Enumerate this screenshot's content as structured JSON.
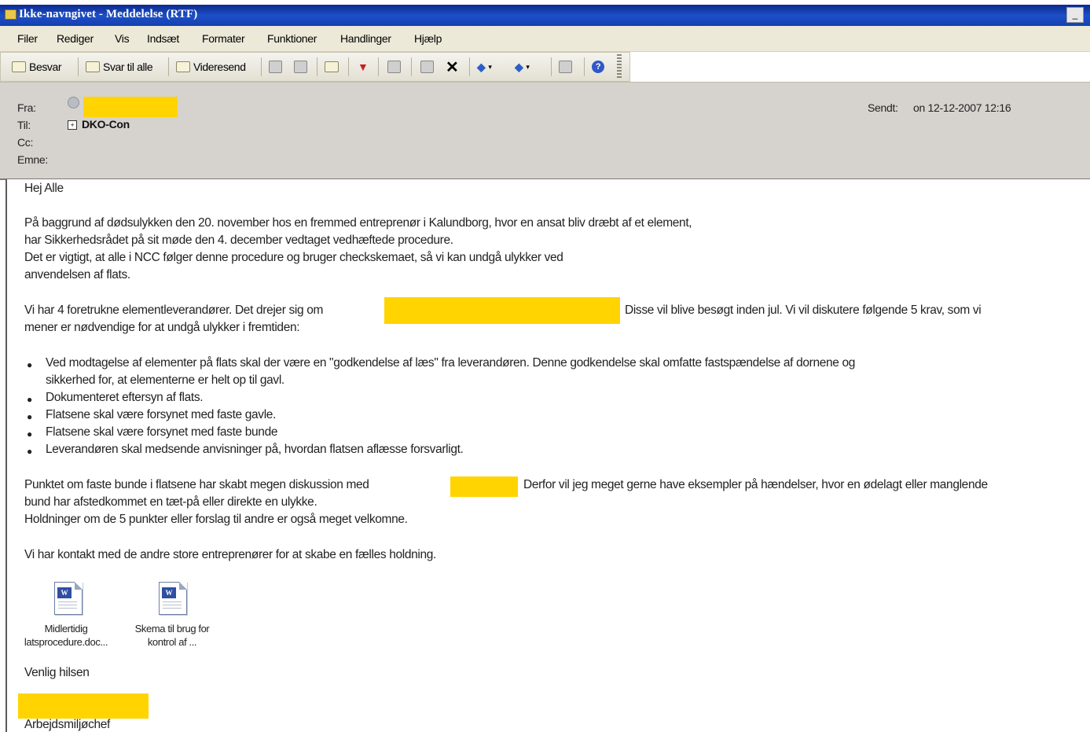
{
  "window": {
    "title": "Ikke-navngivet - Meddelelse (RTF)"
  },
  "menu": [
    "Filer",
    "Rediger",
    "Vis",
    "Indsæt",
    "Formater",
    "Funktioner",
    "Handlinger",
    "Hjælp"
  ],
  "toolbar": {
    "reply": "Besvar",
    "reply_all": "Svar til alle",
    "forward": "Videresend"
  },
  "header": {
    "from_label": "Fra:",
    "to_label": "Til:",
    "cc_label": "Cc:",
    "subject_label": "Emne:",
    "to_value": "DKO-Con",
    "sent_label": "Sendt:",
    "sent_value": "on 12-12-2007 12:16"
  },
  "body": {
    "greeting": "Hej Alle",
    "p1_l1": "På baggrund af dødsulykken den 20. november hos en fremmed entreprenør i Kalundborg, hvor en ansat bliv dræbt af et element,",
    "p1_l2": "har Sikkerhedsrådet på sit møde den 4. december vedtaget vedhæftede procedure.",
    "p1_l3": "Det er vigtigt, at alle i NCC følger denne procedure og bruger checkskemaet, så vi kan undgå ulykker ved",
    "p1_l4": "anvendelsen af flats.",
    "p2_l1a": "Vi har 4 foretrukne elementleverandører. Det drejer sig om",
    "p2_l1b": "Disse vil blive besøgt inden jul. Vi vil diskutere følgende 5 krav, som vi",
    "p2_l2": "mener er nødvendige for at undgå ulykker i fremtiden:",
    "bullets": [
      "Ved modtagelse af elementer på flats skal der være en \"godkendelse af læs\" fra leverandøren. Denne godkendelse skal omfatte fastspændelse af dornene og",
      "Dokumenteret eftersyn af flats.",
      "Flatsene skal være forsynet med faste gavle.",
      "Flatsene skal være forsynet med faste bunde",
      "Leverandøren skal medsende anvisninger på, hvordan flatsen aflæsse forsvarligt."
    ],
    "bullet1_cont": "sikkerhed for, at elementerne er helt op til gavl.",
    "p3_l1a": "Punktet om faste bunde i flatsene har skabt megen diskussion med",
    "p3_l1b": "Derfor vil jeg meget gerne have eksempler på hændelser, hvor en ødelagt eller manglende",
    "p3_l2": "bund har afstedkommet en tæt-på eller direkte en ulykke.",
    "p3_l3": "Holdninger om de 5 punkter eller forslag til andre er også meget velkomne.",
    "p4": "Vi har kontakt med de andre store entreprenører for at skabe en fælles holdning.",
    "attachments": [
      {
        "line1": "Midlertidig",
        "line2": "latsprocedure.doc...",
        "icon": "word-doc-icon"
      },
      {
        "line1": "Skema til brug for",
        "line2": "kontrol af ...",
        "icon": "word-doc-icon"
      }
    ],
    "closing": "Venlig hilsen",
    "signature_title": "Arbejdsmiljøchef"
  },
  "colors": {
    "redaction": "#ffd400",
    "titlebar": "#1540b0",
    "header_bg": "#d6d3ce"
  }
}
